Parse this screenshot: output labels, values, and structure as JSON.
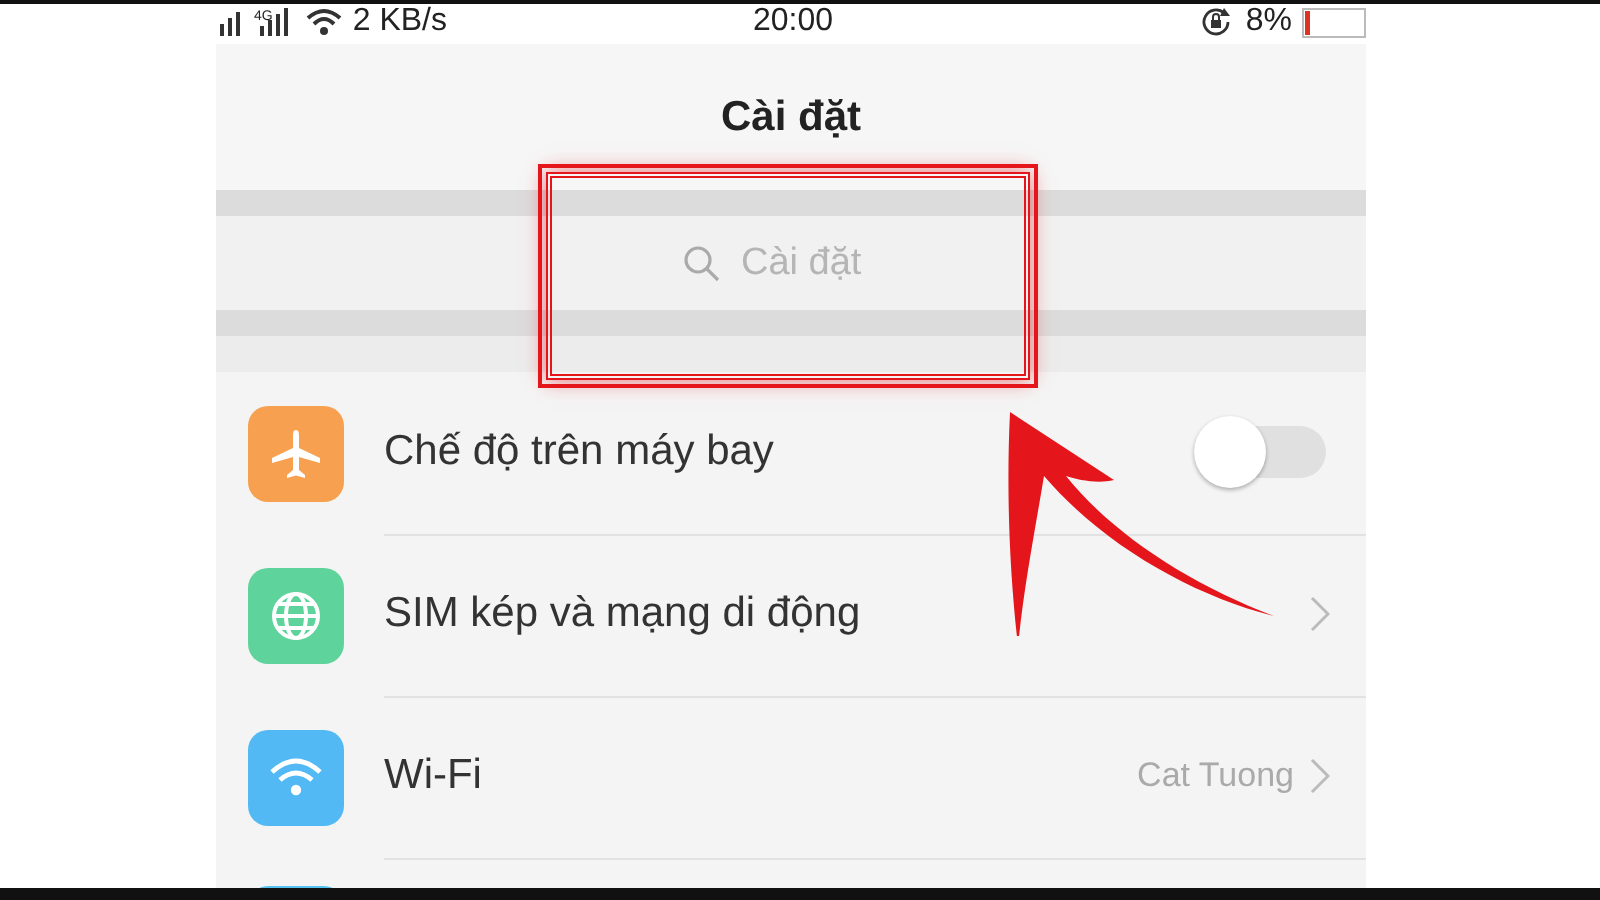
{
  "status_bar": {
    "network_type": "4G",
    "speed": "2 KB/s",
    "time": "20:00",
    "battery": "8%"
  },
  "header": {
    "title": "Cài đặt"
  },
  "search": {
    "placeholder": "Cài đặt"
  },
  "settings": [
    {
      "kind": "toggle",
      "label": "Chế độ trên máy bay",
      "color": "#f7a04f",
      "on": false
    },
    {
      "kind": "link",
      "label": "SIM kép và mạng di động",
      "color": "#5ed49c"
    },
    {
      "kind": "link",
      "label": "Wi-Fi",
      "color": "#52b9f5",
      "value": "Cat Tuong"
    }
  ]
}
